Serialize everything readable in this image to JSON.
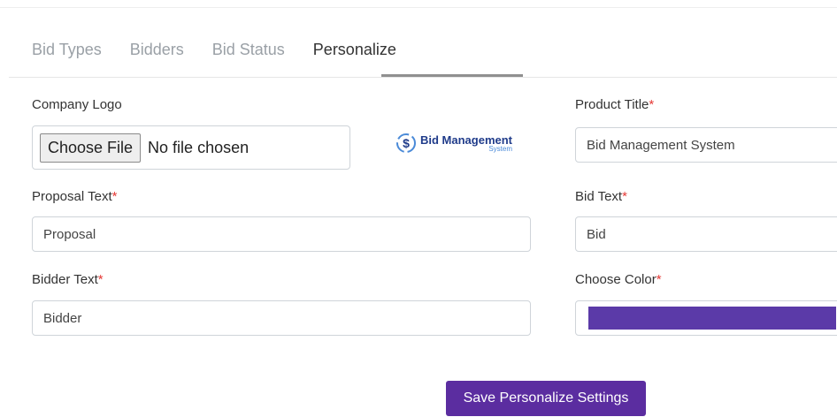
{
  "tabs": [
    {
      "label": "Bid Types"
    },
    {
      "label": "Bidders"
    },
    {
      "label": "Bid Status"
    },
    {
      "label": "Personalize"
    }
  ],
  "active_tab": "Personalize",
  "company_logo": {
    "label": "Company Logo",
    "button": "Choose File",
    "status": "No file chosen",
    "logo_title": "Bid Management",
    "logo_subtitle": "System"
  },
  "product_title": {
    "label": "Product Title",
    "required": "*",
    "value": "Bid Management System"
  },
  "proposal_text": {
    "label": "Proposal Text",
    "required": "*",
    "value": "Proposal"
  },
  "bid_text": {
    "label": "Bid Text",
    "required": "*",
    "value": "Bid"
  },
  "bidder_text": {
    "label": "Bidder Text",
    "required": "*",
    "value": "Bidder"
  },
  "choose_color": {
    "label": "Choose Color",
    "required": "*",
    "value": "#5b3aa8"
  },
  "save_button": "Save Personalize Settings",
  "colors": {
    "accent": "#5b2da0",
    "required": "#e53935"
  }
}
